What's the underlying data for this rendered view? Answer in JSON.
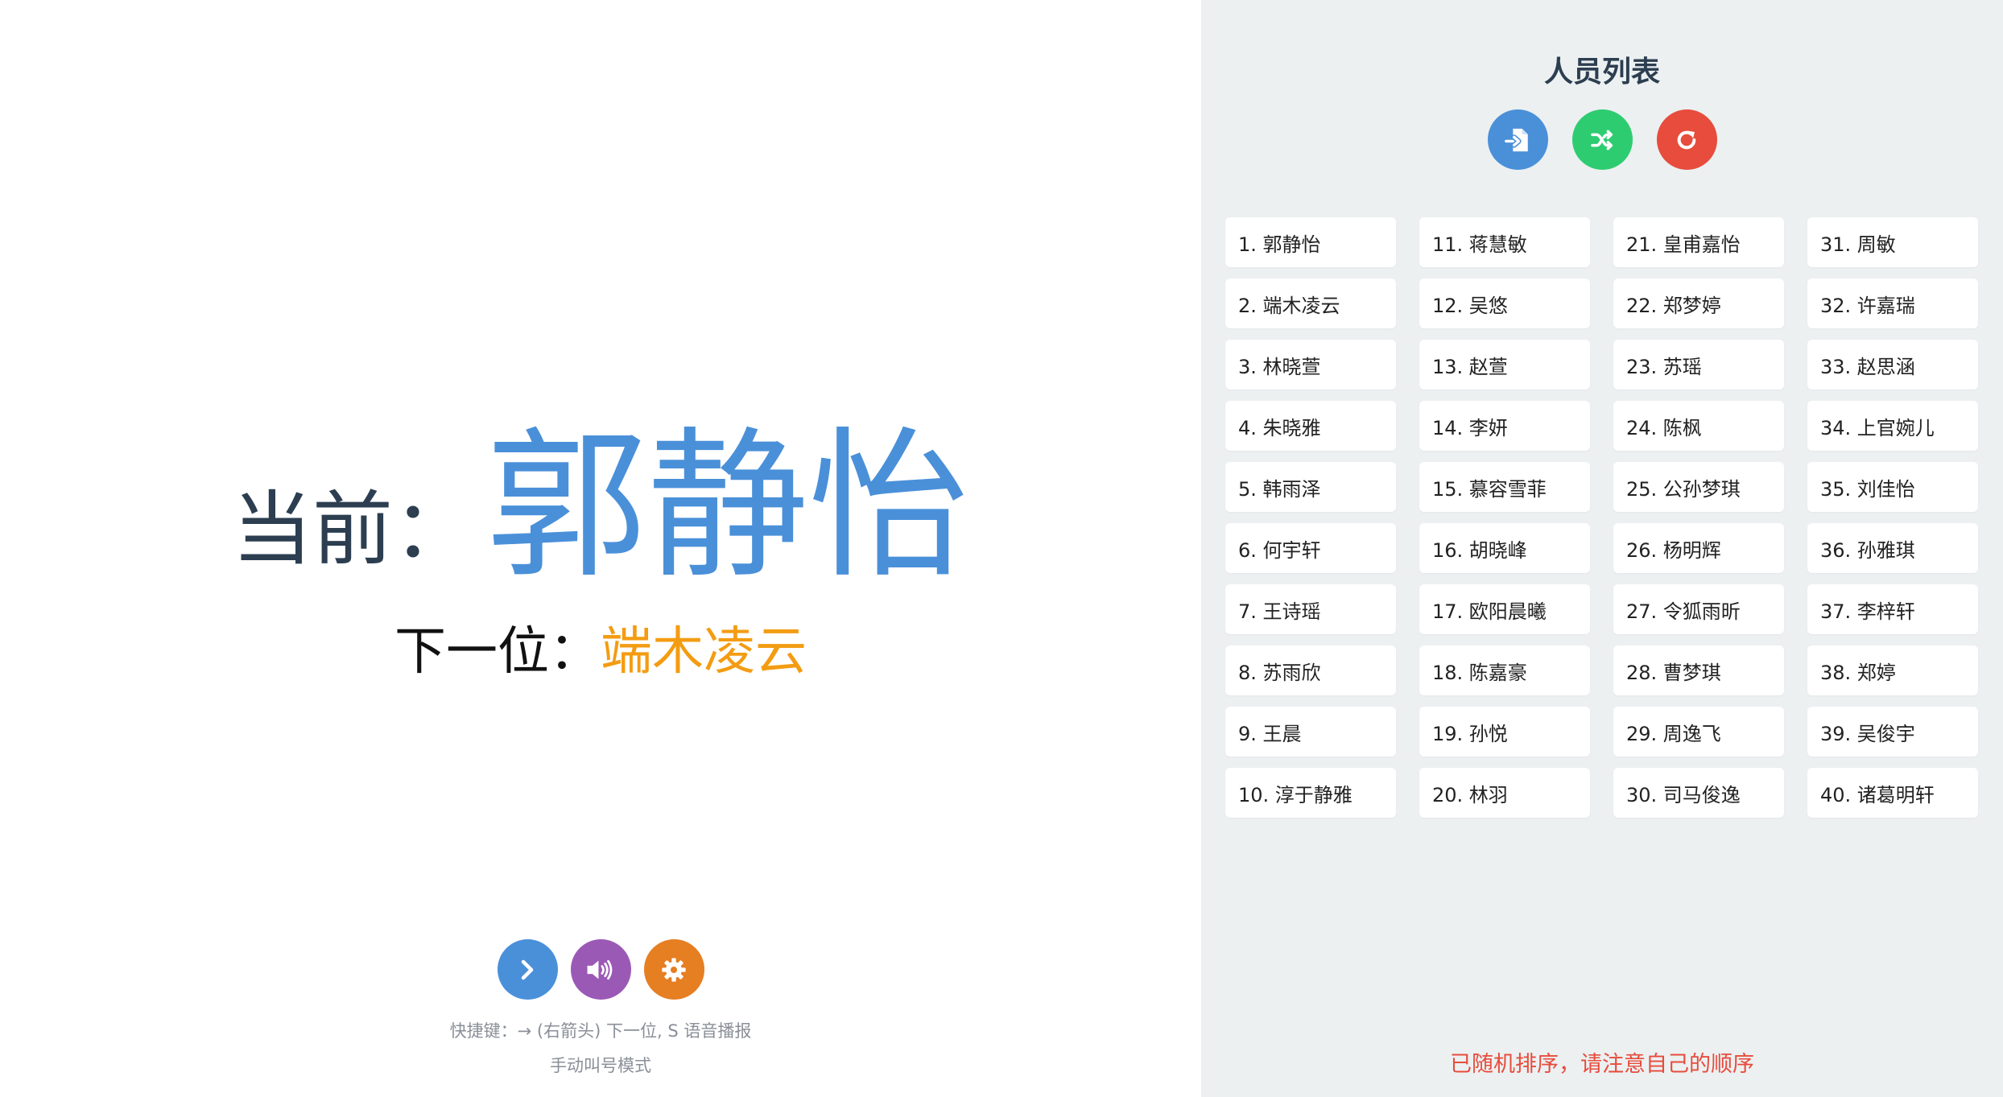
{
  "main": {
    "current_label": "当前：",
    "current_name": "郭静怡",
    "next_label": "下一位：",
    "next_name": "端木凌云",
    "hint_shortcuts": "快捷键：→ (右箭头) 下一位, S 语音播报",
    "hint_mode": "手动叫号模式",
    "buttons": [
      {
        "icon": "chevron-right-icon",
        "color": "#4a90d9"
      },
      {
        "icon": "speaker-icon",
        "color": "#9b59b6"
      },
      {
        "icon": "gear-icon",
        "color": "#e67e22"
      }
    ]
  },
  "sidebar": {
    "title": "人员列表",
    "buttons": [
      {
        "icon": "import-icon",
        "color": "#4a90d9"
      },
      {
        "icon": "shuffle-icon",
        "color": "#2ecc71"
      },
      {
        "icon": "reset-icon",
        "color": "#e74c3c"
      }
    ],
    "people": [
      "1. 郭静怡",
      "2. 端木凌云",
      "3. 林晓萱",
      "4. 朱晓雅",
      "5. 韩雨泽",
      "6. 何宇轩",
      "7. 王诗瑶",
      "8. 苏雨欣",
      "9. 王晨",
      "10. 淳于静雅",
      "11. 蒋慧敏",
      "12. 吴悠",
      "13. 赵萱",
      "14. 李妍",
      "15. 慕容雪菲",
      "16. 胡晓峰",
      "17. 欧阳晨曦",
      "18. 陈嘉豪",
      "19. 孙悦",
      "20. 林羽",
      "21. 皇甫嘉怡",
      "22. 郑梦婷",
      "23. 苏瑶",
      "24. 陈枫",
      "25. 公孙梦琪",
      "26. 杨明辉",
      "27. 令狐雨昕",
      "28. 曹梦琪",
      "29. 周逸飞",
      "30. 司马俊逸",
      "31. 周敏",
      "32. 许嘉瑞",
      "33. 赵思涵",
      "34. 上官婉儿",
      "35. 刘佳怡",
      "36. 孙雅琪",
      "37. 李梓轩",
      "38. 郑婷",
      "39. 吴俊宇",
      "40. 诸葛明轩"
    ],
    "notice": "已随机排序，请注意自己的顺序"
  }
}
